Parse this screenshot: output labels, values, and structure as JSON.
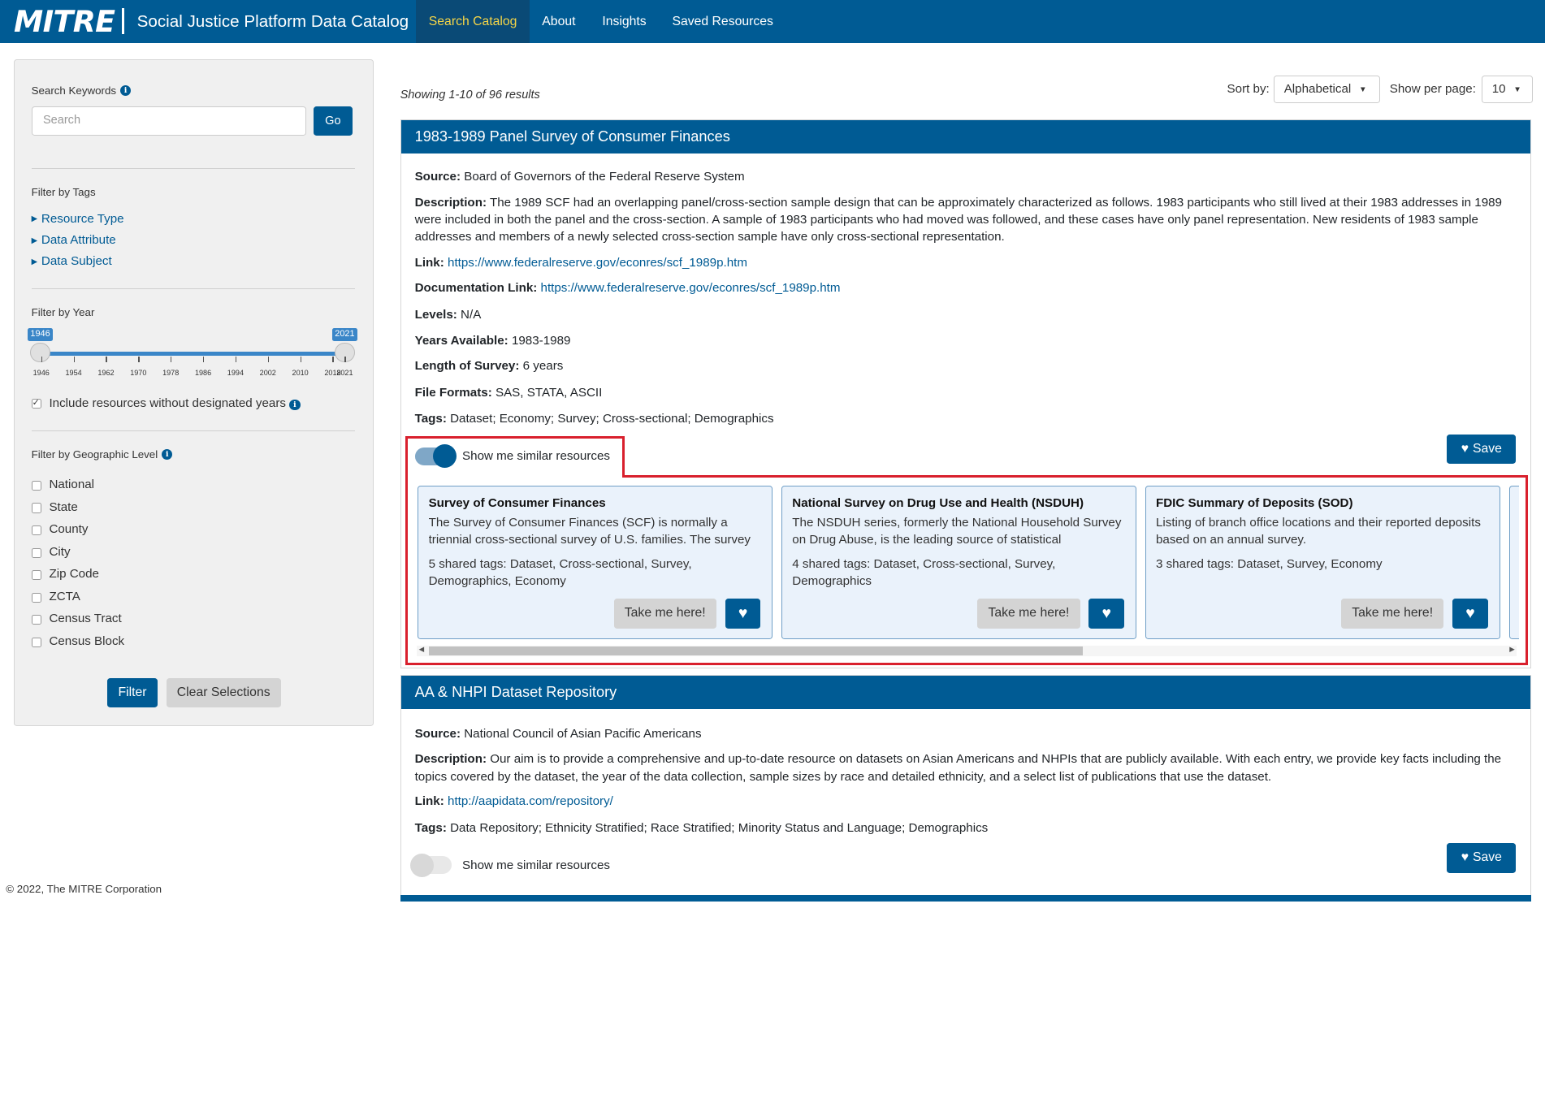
{
  "nav": {
    "logo": "MITRE",
    "title": "Social Justice Platform Data Catalog",
    "items": [
      "Search Catalog",
      "About",
      "Insights",
      "Saved Resources"
    ],
    "active": "Search Catalog"
  },
  "sidebar": {
    "search_label": "Search Keywords",
    "search_placeholder": "Search",
    "go_label": "Go",
    "tags_label": "Filter by Tags",
    "tag_links": [
      "Resource Type",
      "Data Attribute",
      "Data Subject"
    ],
    "year_label": "Filter by Year",
    "year_min": "1946",
    "year_max": "2021",
    "year_selected_min": 1946,
    "year_selected_max": 2021,
    "year_ticks": [
      "1946",
      "1954",
      "1962",
      "1970",
      "1978",
      "1986",
      "1994",
      "2002",
      "2010",
      "2018",
      "2021"
    ],
    "include_label": "Include resources without designated years",
    "include_checked": true,
    "geo_label": "Filter by Geographic Level",
    "geo_levels": [
      "National",
      "State",
      "County",
      "City",
      "Zip Code",
      "ZCTA",
      "Census Tract",
      "Census Block"
    ],
    "filter_label": "Filter",
    "clear_label": "Clear Selections"
  },
  "results": {
    "showing": "Showing 1-10 of 96 results",
    "sort_label": "Sort by:",
    "sort_value": "Alphabetical",
    "perpage_label": "Show per page:",
    "perpage_value": "10"
  },
  "card1": {
    "title": "1983-1989 Panel Survey of Consumer Finances",
    "source_label": "Source:",
    "source": "Board of Governors of the Federal Reserve System",
    "description_label": "Description:",
    "description": "The 1989 SCF had an overlapping panel/cross-section sample design that can be approximately characterized as follows. 1983 participants who still lived at their 1983 addresses in 1989 were included in both the panel and the cross-section. A sample of 1983 participants who had moved was followed, and these cases have only panel representation. New residents of 1983 sample addresses and members of a newly selected cross-section sample have only cross-sectional representation.",
    "link_label": "Link:",
    "link": "https://www.federalreserve.gov/econres/scf_1989p.htm",
    "doc_link_label": "Documentation Link:",
    "doc_link": "https://www.federalreserve.gov/econres/scf_1989p.htm",
    "levels_label": "Levels:",
    "levels": "N/A",
    "years_label": "Years Available:",
    "years": "1983-1989",
    "length_label": "Length of Survey:",
    "length": "6 years",
    "formats_label": "File Formats:",
    "formats": "SAS, STATA, ASCII",
    "tags_label": "Tags:",
    "tags": "Dataset; Economy; Survey; Cross-sectional; Demographics",
    "save_label": "Save",
    "toggle_label": "Show me similar resources",
    "toggle_on": true,
    "similar": [
      {
        "title": "Survey of Consumer Finances",
        "desc": "The Survey of Consumer Finances (SCF) is normally a triennial cross-sectional survey of U.S. families. The survey data include information on families' balance sheets...",
        "tags": "5 shared tags: Dataset, Cross-sectional, Survey, Demographics, Economy",
        "take": "Take me here!"
      },
      {
        "title": "National Survey on Drug Use and Health (NSDUH)",
        "desc": "The NSDUH series, formerly the National Household Survey on Drug Abuse, is the leading source of statistical information...",
        "tags": "4 shared tags: Dataset, Cross-sectional, Survey, Demographics",
        "take": "Take me here!"
      },
      {
        "title": "FDIC Summary of Deposits (SOD)",
        "desc": "Listing of branch office locations and their reported deposits based on an annual survey.",
        "tags": "3 shared tags: Dataset, Survey, Economy",
        "take": "Take me here!"
      }
    ]
  },
  "card2": {
    "title": "AA & NHPI Dataset Repository",
    "source_label": "Source:",
    "source": "National Council of Asian Pacific Americans",
    "description_label": "Description:",
    "description": "Our aim is to provide a comprehensive and up-to-date resource on datasets on Asian Americans and NHPIs that are publicly available. With each entry, we provide key facts including the topics covered by the dataset, the year of the data collection, sample sizes by race and detailed ethnicity, and a select list of publications that use the dataset.",
    "link_label": "Link:",
    "link": "http://aapidata.com/repository/",
    "tags_label": "Tags:",
    "tags": "Data Repository; Ethnicity Stratified; Race Stratified; Minority Status and Language; Demographics",
    "save_label": "Save",
    "toggle_label": "Show me similar resources",
    "toggle_on": false
  },
  "footer": "© 2022, The MITRE Corporation",
  "colors": {
    "brand": "#005b94",
    "active_nav": "#f5d547",
    "highlight": "#d9202d"
  }
}
